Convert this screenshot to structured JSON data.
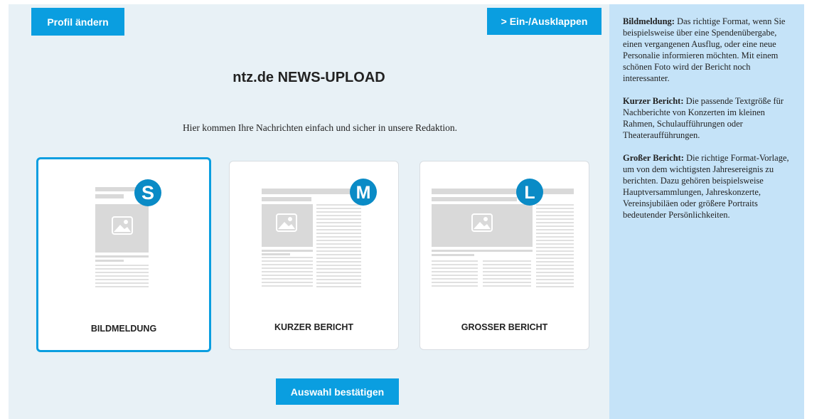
{
  "header": {
    "profile_button": "Profil ändern",
    "toggle_button": "> Ein-/Ausklappen"
  },
  "main": {
    "title": "ntz.de NEWS-UPLOAD",
    "subtitle": "Hier kommen Ihre Nachrichten einfach und sicher in unsere Redaktion.",
    "confirm_button": "Auswahl bestätigen"
  },
  "cards": [
    {
      "badge": "S",
      "label": "BILDMELDUNG",
      "selected": true
    },
    {
      "badge": "M",
      "label": "KURZER BERICHT",
      "selected": false
    },
    {
      "badge": "L",
      "label": "GROSSER BERICHT",
      "selected": false
    }
  ],
  "sidebar": {
    "items": [
      {
        "heading": "Bildmeldung:",
        "text": " Das richtige Format, wenn Sie beispielsweise über eine Spendenübergabe, einen vergangenen Ausflug, oder eine neue Personalie informieren möchten. Mit einem schönen Foto wird der Bericht noch interessanter."
      },
      {
        "heading": "Kurzer Bericht:",
        "text": " Die passende Textgröße für Nachberichte von Konzerten im kleinen Rahmen, Schulaufführungen oder Theateraufführungen."
      },
      {
        "heading": "Großer Bericht:",
        "text": " Die richtige Format-Vorlage, um von dem wichtigsten Jahresereignis zu berichten. Dazu gehören beispielsweise Hauptversammlungen, Jahreskonzerte, Vereinsjubiläen oder größere Portraits bedeutender Persönlichkeiten."
      }
    ]
  },
  "colors": {
    "accent": "#0a9ee0",
    "badge": "#0a8bc6",
    "main_bg": "#e8f1f6",
    "sidebar_bg": "#c5e3f8",
    "placeholder": "#d9d9d9"
  },
  "icons": [
    "image-placeholder-icon"
  ]
}
